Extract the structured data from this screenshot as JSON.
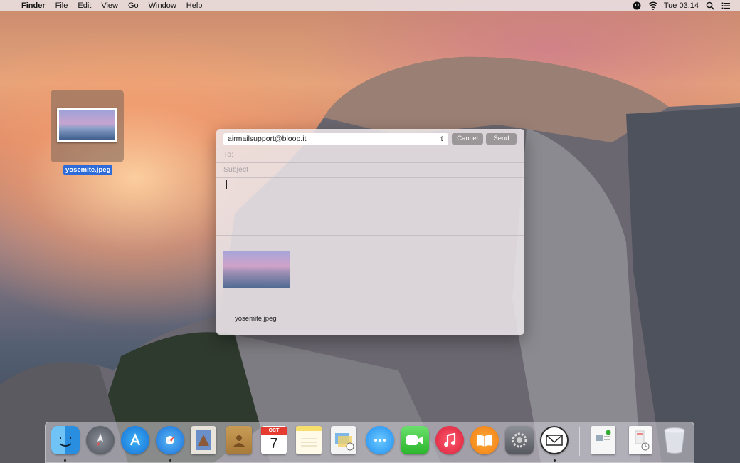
{
  "menubar": {
    "apple_glyph": "",
    "app_name": "Finder",
    "menus": [
      "File",
      "Edit",
      "View",
      "Go",
      "Window",
      "Help"
    ],
    "clock": "Tue 03:14",
    "status_icons": [
      "user-icon",
      "wifi-icon",
      "spotlight-icon",
      "notification-center-icon"
    ]
  },
  "desktop": {
    "file_name": "yosemite.jpeg"
  },
  "mail_sheet": {
    "from_value": "airmailsupport@bloop.it",
    "cancel_label": "Cancel",
    "send_label": "Send",
    "to_placeholder": "To:",
    "subject_placeholder": "Subject",
    "attachment_name": "yosemite.jpeg"
  },
  "dock": {
    "apps": [
      {
        "name": "finder-icon",
        "running": true
      },
      {
        "name": "launchpad-icon",
        "running": false
      },
      {
        "name": "app-store-icon",
        "running": false
      },
      {
        "name": "safari-icon",
        "running": true
      },
      {
        "name": "mail-icon",
        "running": false
      },
      {
        "name": "contacts-icon",
        "running": false
      },
      {
        "name": "calendar-icon",
        "running": false
      },
      {
        "name": "notes-icon",
        "running": false
      },
      {
        "name": "reminders-icon",
        "running": false
      },
      {
        "name": "messages-icon",
        "running": false
      },
      {
        "name": "facetime-icon",
        "running": false
      },
      {
        "name": "itunes-icon",
        "running": false
      },
      {
        "name": "ibooks-icon",
        "running": false
      },
      {
        "name": "system-preferences-icon",
        "running": false
      },
      {
        "name": "airmail-icon",
        "running": true
      }
    ],
    "calendar": {
      "month": "OCT",
      "day": "7"
    },
    "others": [
      "document-icon",
      "recent-items-icon",
      "trash-icon"
    ]
  },
  "colors": {
    "selection_blue": "#2c6bd8",
    "sheet_button_gray": "#9b9697"
  }
}
